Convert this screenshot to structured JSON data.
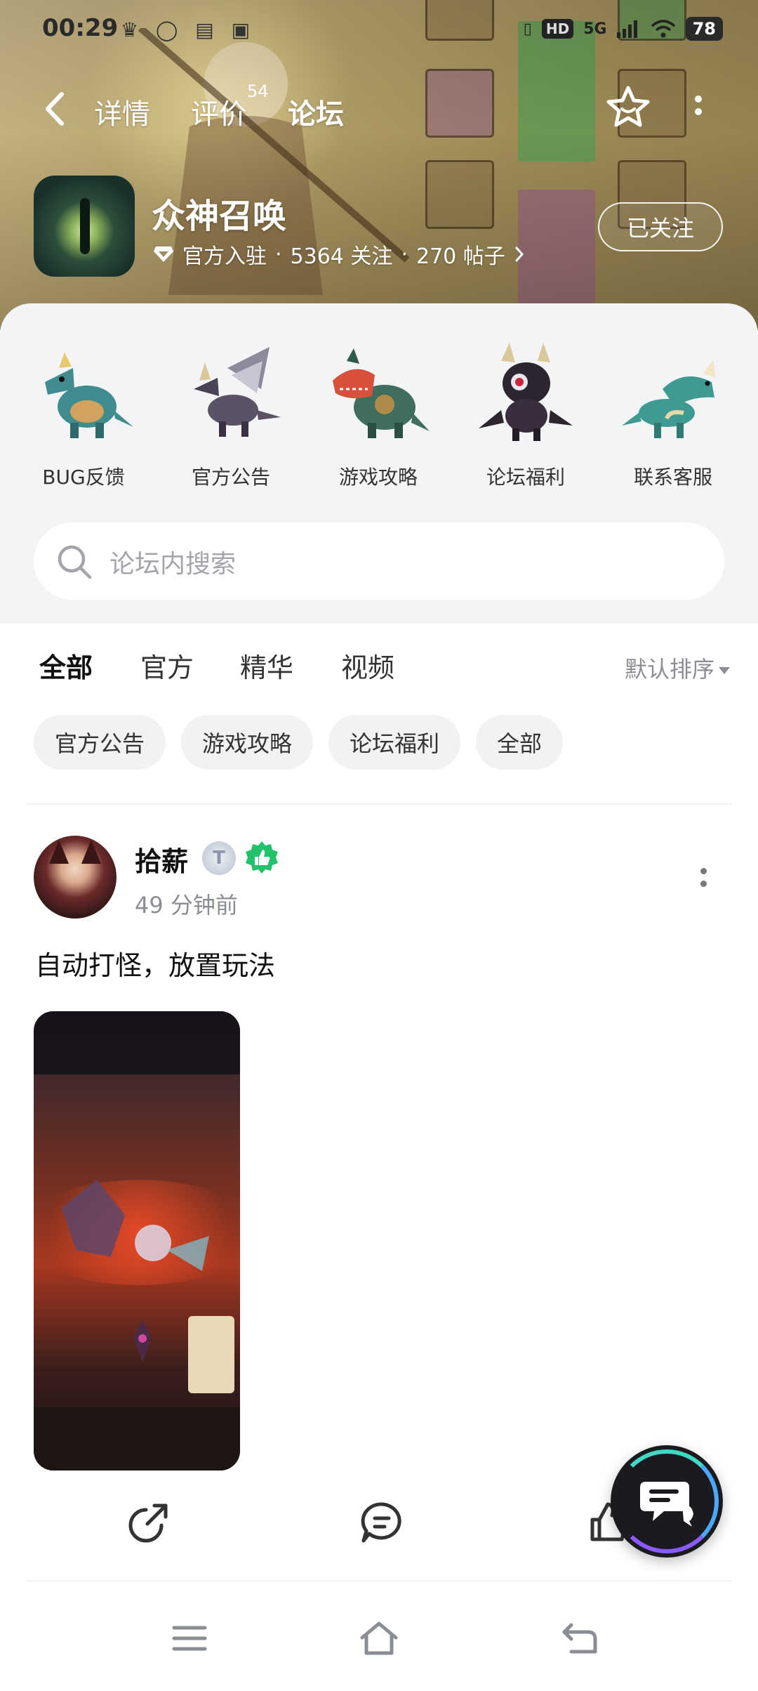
{
  "status_bar": {
    "time": "00:29",
    "network": "5G",
    "hd": "HD",
    "battery": "78"
  },
  "nav": {
    "tabs": [
      {
        "label": "详情"
      },
      {
        "label": "评价",
        "count": "54"
      },
      {
        "label": "论坛",
        "active": true
      }
    ]
  },
  "game": {
    "name": "众神召唤",
    "official": "官方入驻",
    "followers": "5364 关注",
    "posts": "270 帖子",
    "follow_button": "已关注"
  },
  "quick_links": [
    {
      "label": "BUG反馈",
      "icon": "teal-dragon-icon"
    },
    {
      "label": "官方公告",
      "icon": "winged-dragon-icon"
    },
    {
      "label": "游戏攻略",
      "icon": "red-dragon-icon"
    },
    {
      "label": "论坛福利",
      "icon": "dark-dragon-icon"
    },
    {
      "label": "联系客服",
      "icon": "green-dragon-icon"
    }
  ],
  "search": {
    "placeholder": "论坛内搜索"
  },
  "content_tabs": [
    {
      "label": "全部",
      "active": true
    },
    {
      "label": "官方"
    },
    {
      "label": "精华"
    },
    {
      "label": "视频"
    }
  ],
  "sort": {
    "label": "默认排序"
  },
  "chips": [
    "官方公告",
    "游戏攻略",
    "论坛福利",
    "全部"
  ],
  "post": {
    "author": "拾薪",
    "level": "T",
    "time": "49 分钟前",
    "text": "自动打怪，放置玩法"
  },
  "colors": {
    "accent": "#19d4bd",
    "panel_bg": "#f3f4f6",
    "chip_bg": "#f1f2f4",
    "muted_text": "#8a8d93",
    "badge_green": "#22c26b"
  }
}
